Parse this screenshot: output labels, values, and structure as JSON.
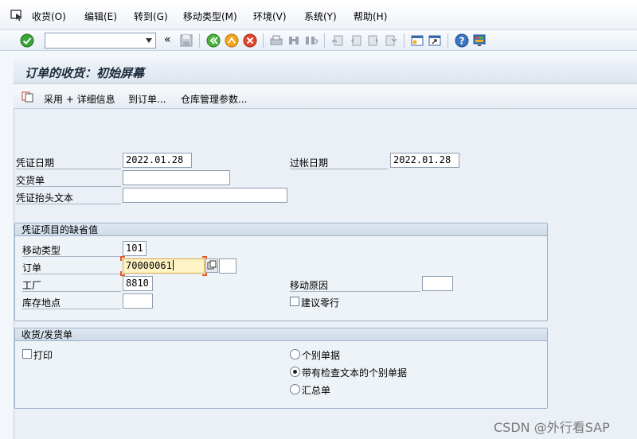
{
  "menu": [
    {
      "label": "收货(O)"
    },
    {
      "label": "编辑(E)"
    },
    {
      "label": "转到(G)"
    },
    {
      "label": "移动类型(M)"
    },
    {
      "label": "环境(V)"
    },
    {
      "label": "系统(Y)"
    },
    {
      "label": "帮助(H)"
    }
  ],
  "toolbar": {
    "command_field_value": "",
    "back_glyph": "«"
  },
  "title": "订单的收货：初始屏幕",
  "app_toolbar": {
    "adopt_label": "采用 + 详细信息",
    "to_order_label": "到订单...",
    "wm_params_label": "仓库管理参数..."
  },
  "header": {
    "doc_date_label": "凭证日期",
    "doc_date_value": "2022.01.28",
    "posting_date_label": "过帐日期",
    "posting_date_value": "2022.01.28",
    "delivery_note_label": "交货单",
    "delivery_note_value": "",
    "header_text_label": "凭证抬头文本",
    "header_text_value": ""
  },
  "defaults": {
    "title": "凭证项目的缺省值",
    "movement_type_label": "移动类型",
    "movement_type_value": "101",
    "order_label": "订单",
    "order_value": "70000061",
    "order_item_value": "",
    "plant_label": "工厂",
    "plant_value": "8810",
    "reason_label": "移动原因",
    "reason_value": "",
    "sloc_label": "库存地点",
    "sloc_value": "",
    "suggest_zero_label": "建议零行",
    "suggest_zero_checked": false
  },
  "slip": {
    "title": "收货/发货单",
    "print_label": "打印",
    "print_checked": false,
    "options": [
      {
        "label": "个别单据",
        "selected": false
      },
      {
        "label": "带有检查文本的个别单据",
        "selected": true
      },
      {
        "label": "汇总单",
        "selected": false
      }
    ]
  },
  "watermark": "CSDN @外行看SAP",
  "colors": {
    "accent_active_field": "#fdf3c4",
    "focus_corner": "#e05a2b"
  }
}
